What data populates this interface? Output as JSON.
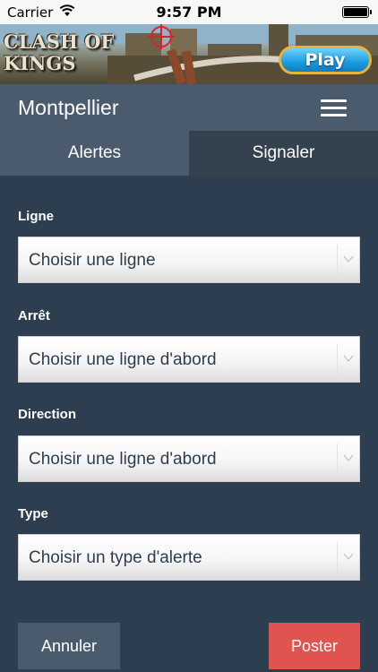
{
  "status_bar": {
    "carrier": "Carrier",
    "time": "9:57 PM"
  },
  "ad": {
    "logo_line1": "CLASH OF",
    "logo_line2": "KINGS",
    "play_label": "Play"
  },
  "header": {
    "city": "Montpellier"
  },
  "tabs": [
    {
      "label": "Alertes"
    },
    {
      "label": "Signaler"
    }
  ],
  "form": {
    "fields": [
      {
        "label": "Ligne",
        "value": "Choisir une ligne"
      },
      {
        "label": "Arrêt",
        "value": "Choisir une ligne d'abord"
      },
      {
        "label": "Direction",
        "value": "Choisir une ligne d'abord"
      },
      {
        "label": "Type",
        "value": "Choisir un type d'alerte"
      }
    ]
  },
  "actions": {
    "cancel_label": "Annuler",
    "post_label": "Poster"
  },
  "colors": {
    "background": "#2c3e50",
    "header": "#4a5b6e",
    "tab_active": "#34414e",
    "post_button": "#e0534e"
  }
}
